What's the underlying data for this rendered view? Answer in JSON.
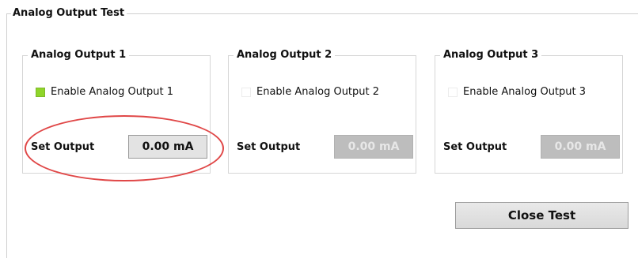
{
  "group": {
    "title": "Analog Output Test"
  },
  "panels": [
    {
      "title": "Analog Output 1",
      "checkbox_label": "Enable Analog Output  1",
      "enabled": true,
      "set_label": "Set Output",
      "value": "0.00 mA"
    },
    {
      "title": "Analog Output 2",
      "checkbox_label": "Enable Analog Output  2",
      "enabled": false,
      "set_label": "Set Output",
      "value": "0.00 mA"
    },
    {
      "title": "Analog Output 3",
      "checkbox_label": "Enable Analog Output  3",
      "enabled": false,
      "set_label": "Set Output",
      "value": "0.00 mA"
    }
  ],
  "close_button": {
    "label": "Close Test"
  },
  "colors": {
    "checked": "#8fd52a",
    "highlight": "#e04747",
    "disabled_button": "#bdbdbd"
  }
}
